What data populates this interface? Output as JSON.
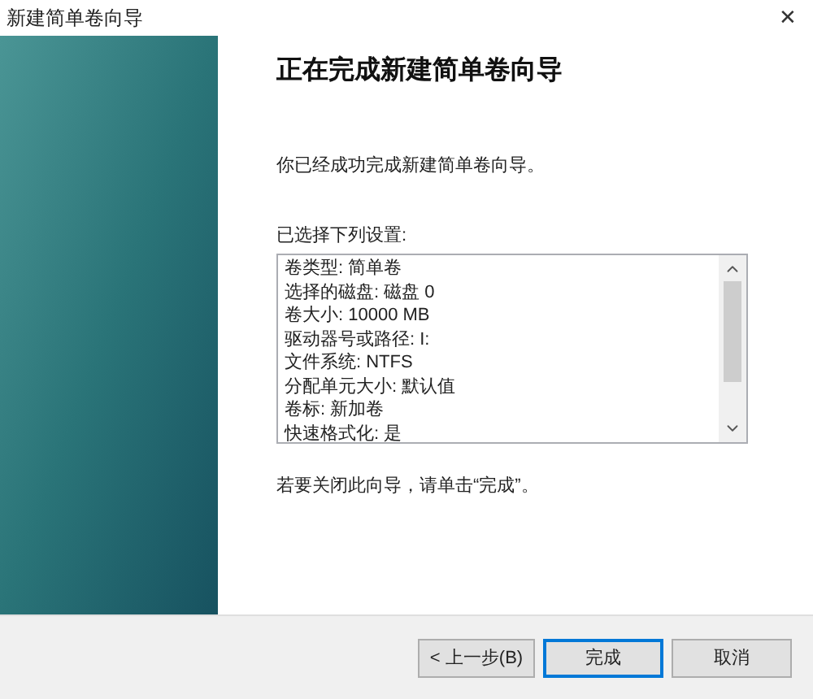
{
  "window": {
    "title": "新建简单卷向导",
    "close": "✕"
  },
  "heading": "正在完成新建简单卷向导",
  "intro": "你已经成功完成新建简单卷向导。",
  "settings_label": "已选择下列设置:",
  "settings": [
    "卷类型: 简单卷",
    "选择的磁盘: 磁盘 0",
    "卷大小: 10000 MB",
    "驱动器号或路径: I:",
    "文件系统: NTFS",
    "分配单元大小: 默认值",
    "卷标: 新加卷",
    "快速格式化: 是"
  ],
  "closing_note": "若要关闭此向导，请单击“完成”。",
  "buttons": [
    {
      "label": "< 上一步(B)",
      "selected": false
    },
    {
      "label": "完成",
      "selected": true
    },
    {
      "label": "取消",
      "selected": false
    }
  ]
}
